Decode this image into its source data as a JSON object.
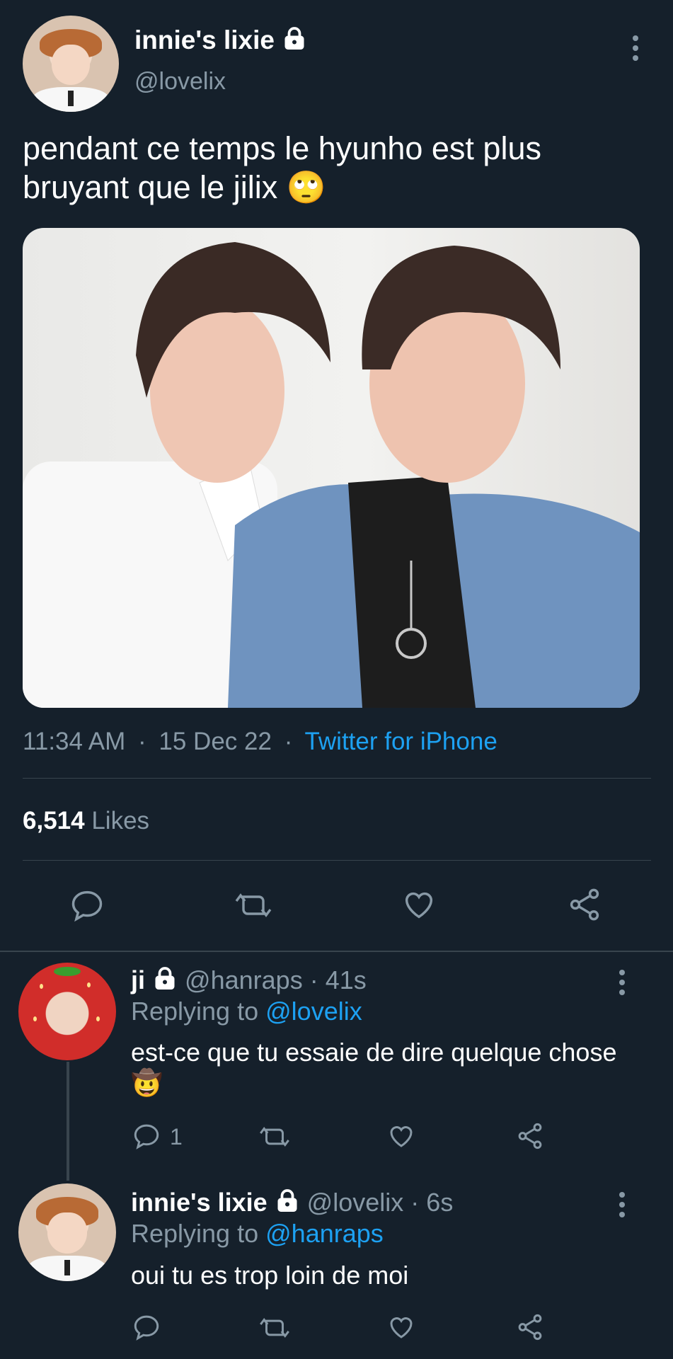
{
  "tweet": {
    "display_name": "innie's lixie",
    "handle": "@lovelix",
    "text": "pendant ce temps le hyunho est plus bruyant que le jilix 🙄",
    "time": "11:34 AM",
    "date": "15 Dec 22",
    "separator": "·",
    "source": "Twitter for iPhone",
    "likes_count": "6,514",
    "likes_label": "Likes"
  },
  "replies": [
    {
      "display_name": "ji",
      "handle": "@hanraps",
      "age": "41s",
      "replying_prefix": "Replying to",
      "replying_to": "@lovelix",
      "text": "est-ce que tu essaie de dire quelque chose 🤠",
      "reply_count": "1"
    },
    {
      "display_name": "innie's lixie",
      "handle": "@lovelix",
      "age": "6s",
      "replying_prefix": "Replying to",
      "replying_to": "@hanraps",
      "text": "oui tu es trop loin de moi",
      "reply_count": ""
    }
  ],
  "colors": {
    "background": "#15202b",
    "muted": "#8899a6",
    "link": "#1da1f2",
    "divider": "#38444d"
  },
  "icons": [
    "lock-icon",
    "more-icon",
    "reply-icon",
    "retweet-icon",
    "like-icon",
    "share-icon"
  ]
}
